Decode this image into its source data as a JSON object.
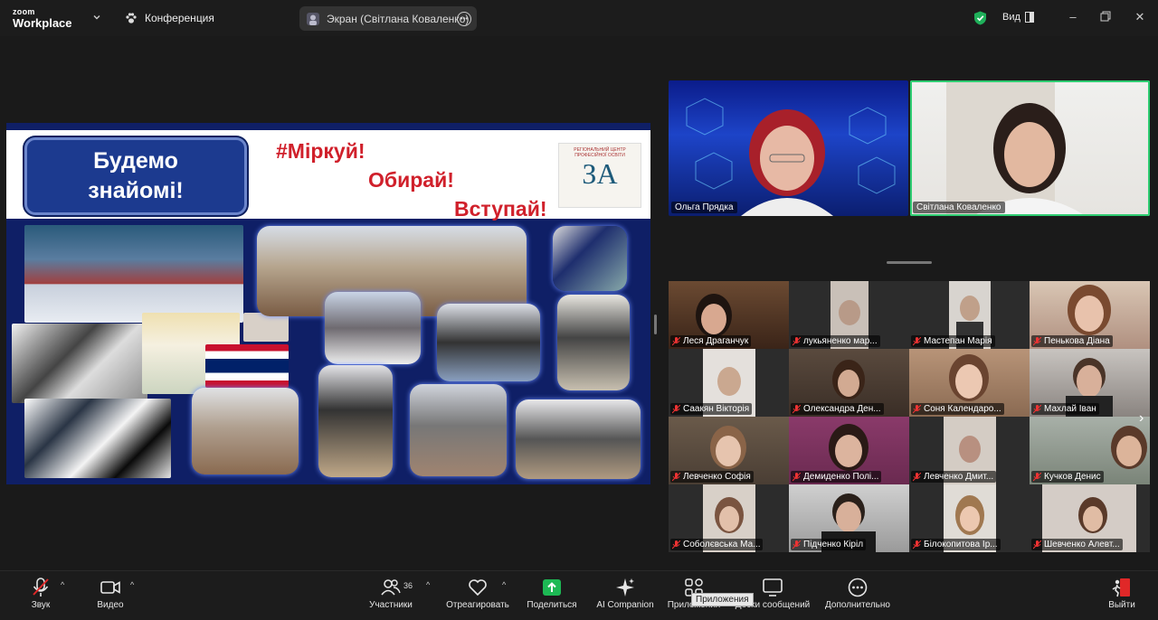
{
  "app": {
    "logo_top": "zoom",
    "logo_bottom": "Workplace"
  },
  "header": {
    "meeting_label": "Конференция",
    "share_label": "Экран (Світлана Коваленко)",
    "view_label": "Вид"
  },
  "slide": {
    "title_line1": "Будемо",
    "title_line2": "знайомі!",
    "slogan1": "#Міркуй!",
    "slogan2": "Обирай!",
    "slogan3": "Вступай!",
    "center_text": "РЕГІОНАЛЬНИЙ ЦЕНТР ПРОФЕСІЙНОЇ ОСВІТИ",
    "center_letter": "ЗА"
  },
  "speakers": [
    {
      "name": "Ольга Прядка",
      "active": false
    },
    {
      "name": "Світлана Коваленко",
      "active": true
    }
  ],
  "participants": [
    "Леся Драганчук",
    "лукьяненко мар...",
    "Мастепан Марія",
    "Пенькова Діана",
    "Саакян Вікторія",
    "Олександра Ден...",
    "Соня Календаро...",
    "Махлай Іван",
    "Левченко Софія",
    "Демиденко Полі...",
    "Левченко Дмит...",
    "Кучков Денис",
    "Соболєвська Ма...",
    "Підченко Кіріл",
    "Білокопитова Ір...",
    "Шевченко Алевт..."
  ],
  "toolbar": {
    "audio": "Звук",
    "video": "Видео",
    "participants": "Участники",
    "participants_count": "36",
    "react": "Отреагировать",
    "share": "Поделиться",
    "ai": "AI Companion",
    "apps": "Приложения",
    "chat": "Доски сообщений",
    "more": "Дополнительно",
    "leave": "Выйти",
    "tooltip": "Приложения"
  },
  "colors": {
    "accent_green": "#2ecc71",
    "share_green": "#1db954",
    "leave_red": "#e02828"
  }
}
